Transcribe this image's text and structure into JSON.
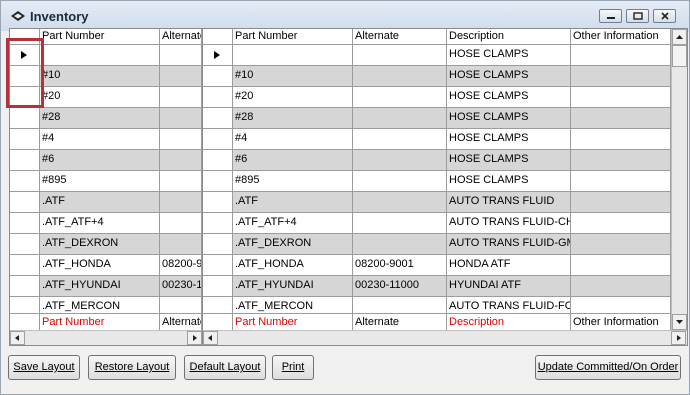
{
  "window": {
    "title": "Inventory"
  },
  "left_grid": {
    "headers": [
      "Part Number",
      "Alternate"
    ],
    "rows": [
      [
        "",
        ""
      ],
      [
        "#10",
        ""
      ],
      [
        "#20",
        ""
      ],
      [
        "#28",
        ""
      ],
      [
        "#4",
        ""
      ],
      [
        "#6",
        ""
      ],
      [
        "#895",
        ""
      ],
      [
        ".ATF",
        ""
      ],
      [
        ".ATF_ATF+4",
        ""
      ],
      [
        ".ATF_DEXRON",
        ""
      ],
      [
        ".ATF_HONDA",
        "08200-9"
      ],
      [
        ".ATF_HYUNDAI",
        "00230-1"
      ],
      [
        ".ATF_MERCON",
        ""
      ]
    ],
    "footer": [
      "Part Number",
      "Alternate"
    ]
  },
  "right_grid": {
    "headers": [
      "Part Number",
      "Alternate",
      "Description",
      "Other Information"
    ],
    "rows": [
      [
        "",
        "",
        "HOSE CLAMPS",
        ""
      ],
      [
        "#10",
        "",
        "HOSE CLAMPS",
        ""
      ],
      [
        "#20",
        "",
        "HOSE CLAMPS",
        ""
      ],
      [
        "#28",
        "",
        "HOSE CLAMPS",
        ""
      ],
      [
        "#4",
        "",
        "HOSE CLAMPS",
        ""
      ],
      [
        "#6",
        "",
        "HOSE CLAMPS",
        ""
      ],
      [
        "#895",
        "",
        "HOSE CLAMPS",
        ""
      ],
      [
        ".ATF",
        "",
        "AUTO TRANS FLUID",
        ""
      ],
      [
        ".ATF_ATF+4",
        "",
        "AUTO TRANS FLUID-CH",
        ""
      ],
      [
        ".ATF_DEXRON",
        "",
        "AUTO TRANS FLUID-GM",
        ""
      ],
      [
        ".ATF_HONDA",
        "08200-9001",
        "HONDA ATF",
        ""
      ],
      [
        ".ATF_HYUNDAI",
        "00230-11000",
        "HYUNDAI ATF",
        ""
      ],
      [
        ".ATF_MERCON",
        "",
        "AUTO TRANS FLUID-FO",
        ""
      ]
    ],
    "footer": [
      "Part Number",
      "Alternate",
      "Description",
      "Other Information"
    ]
  },
  "buttons": {
    "save_layout": "Save Layout",
    "restore_layout": "Restore Layout",
    "default_layout": "Default Layout",
    "print": "Print",
    "update_committed": "Update Committed/On Order"
  },
  "colors": {
    "highlight": "#b3333a",
    "footer_red": "#e00000",
    "row_gray": "#d6d6d6"
  }
}
